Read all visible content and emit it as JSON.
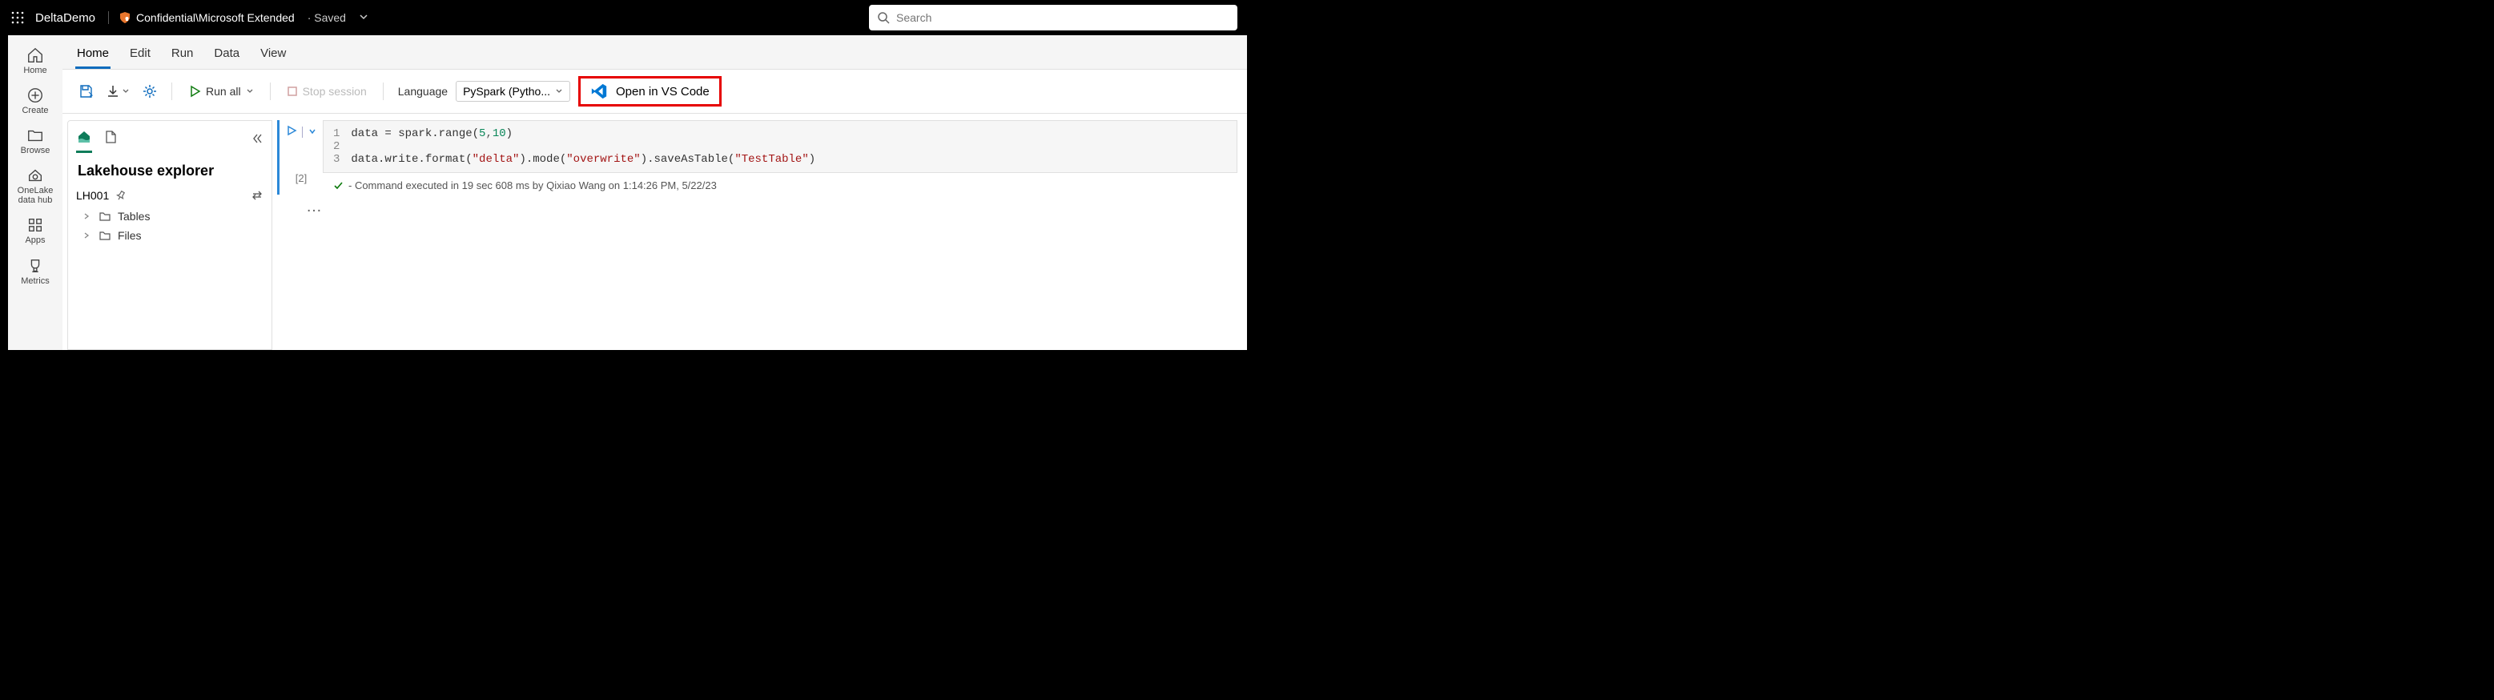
{
  "header": {
    "workspace_name": "DeltaDemo",
    "classification_label": "Confidential\\Microsoft Extended",
    "saved_status": "Saved",
    "search_placeholder": "Search"
  },
  "leftnav": {
    "items": [
      {
        "label": "Home",
        "icon": "home"
      },
      {
        "label": "Create",
        "icon": "plus-circle"
      },
      {
        "label": "Browse",
        "icon": "folder"
      },
      {
        "label": "OneLake data hub",
        "icon": "onelake"
      },
      {
        "label": "Apps",
        "icon": "apps"
      },
      {
        "label": "Metrics",
        "icon": "trophy"
      }
    ]
  },
  "tabs": {
    "items": [
      "Home",
      "Edit",
      "Run",
      "Data",
      "View"
    ],
    "active": "Home"
  },
  "toolbar": {
    "run_all_label": "Run all",
    "stop_session_label": "Stop session",
    "language_label": "Language",
    "language_value": "PySpark (Pytho...",
    "open_vscode_label": "Open in VS Code"
  },
  "explorer": {
    "title": "Lakehouse explorer",
    "lakehouse_name": "LH001",
    "tree_items": [
      {
        "label": "Tables"
      },
      {
        "label": "Files"
      }
    ]
  },
  "cell": {
    "exec_count": "[2]",
    "line_numbers": [
      "1",
      "2",
      "3"
    ],
    "code_line1_pre": "data = spark.range(",
    "code_num1": "5",
    "code_comma": ",",
    "code_num2": "10",
    "code_line1_post": ")",
    "code_line3_pre": "data.write.format(",
    "code_str1": "\"delta\"",
    "code_mid1": ").mode(",
    "code_str2": "\"overwrite\"",
    "code_mid2": ").saveAsTable(",
    "code_str3": "\"TestTable\"",
    "code_line3_post": ")",
    "status_text": "- Command executed in 19 sec 608 ms by Qixiao Wang on 1:14:26 PM, 5/22/23",
    "ellipsis": "…"
  }
}
